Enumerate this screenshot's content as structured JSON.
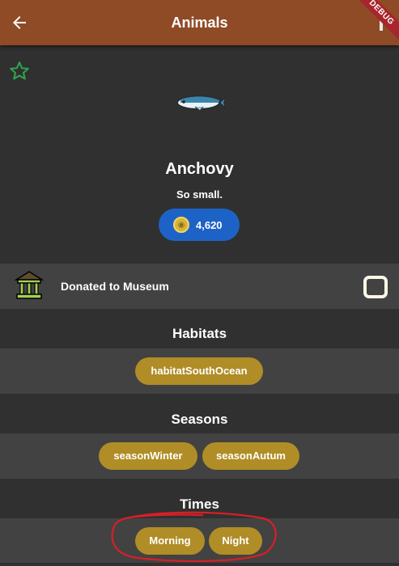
{
  "appbar": {
    "title": "Animals",
    "debug_label": "DEBUG"
  },
  "item": {
    "name": "Anchovy",
    "quote": "So small.",
    "price": "4,620"
  },
  "museum": {
    "label": "Donated to Museum",
    "checked": false
  },
  "habitats": {
    "title": "Habitats",
    "chips": [
      "habitatSouthOcean"
    ]
  },
  "seasons": {
    "title": "Seasons",
    "chips": [
      "seasonWinter",
      "seasonAutum"
    ]
  },
  "times": {
    "title": "Times",
    "chips": [
      "Morning",
      "Night"
    ]
  },
  "colors": {
    "appbar": "#8f4a26",
    "chip": "#b08d26",
    "price_pill": "#1d63c7",
    "favorite_outline": "#2fa34a",
    "annotation": "#d81f26"
  }
}
